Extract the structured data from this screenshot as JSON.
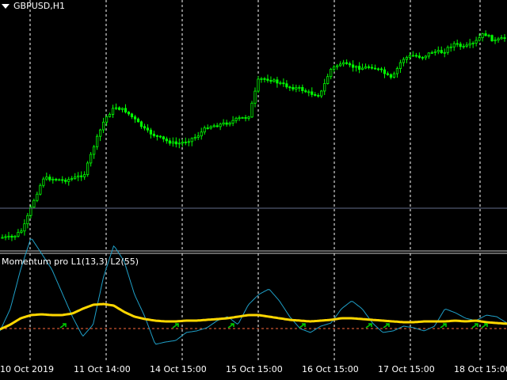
{
  "window": {
    "symbol_title": "GBPUSD,H1",
    "indicator_title": "Momentum pro L1(13,3) L2(55)"
  },
  "time_axis": {
    "labels": [
      "10 Oct 2019",
      "11 Oct 14:00",
      "14 Oct 15:00",
      "15 Oct 15:00",
      "16 Oct 15:00",
      "17 Oct 15:00",
      "18 Oct 15:00"
    ]
  },
  "colors": {
    "background": "#000000",
    "grid": "#ffffff",
    "candle": "#00ff00",
    "momentum_fast": "#1fa0c8",
    "momentum_slow": "#ffd700",
    "signal_arrow": "#00c800",
    "zero_level": "#ff6a3c"
  },
  "chart_data": [
    {
      "type": "candlestick",
      "series_name": "GBPUSD,H1",
      "x_labels": [
        "10 Oct 2019",
        "11 Oct 14:00",
        "14 Oct 15:00",
        "15 Oct 15:00",
        "16 Oct 15:00",
        "17 Oct 15:00",
        "18 Oct 15:00"
      ],
      "trend_closes": [
        300,
        300,
        290,
        255,
        225,
        226,
        228,
        225,
        220,
        182,
        150,
        135,
        140,
        152,
        165,
        172,
        178,
        182,
        178,
        172,
        160,
        158,
        155,
        150,
        148,
        100,
        100,
        105,
        110,
        112,
        118,
        120,
        88,
        80,
        84,
        86,
        84,
        90,
        100,
        75,
        70,
        72,
        65,
        66,
        55,
        60,
        55,
        42,
        52,
        48
      ],
      "grid": true,
      "y_axis": "hidden"
    },
    {
      "type": "line",
      "series": [
        {
          "style": "thin",
          "values": [
            418,
            390,
            340,
            300,
            320,
            340,
            370,
            400,
            425,
            410,
            350,
            310,
            330,
            372,
            400,
            435,
            432,
            430,
            420,
            418,
            414,
            405,
            400,
            410,
            385,
            372,
            365,
            380,
            400,
            415,
            420,
            412,
            408,
            390,
            380,
            390,
            408,
            420,
            418,
            412,
            414,
            418,
            412,
            390,
            395,
            402,
            405,
            398,
            400,
            408
          ]
        },
        {
          "style": "thick",
          "values": [
            416,
            410,
            402,
            398,
            397,
            398,
            398,
            396,
            390,
            385,
            384,
            386,
            394,
            400,
            403,
            405,
            406,
            406,
            405,
            405,
            404,
            403,
            402,
            400,
            398,
            398,
            400,
            402,
            404,
            405,
            406,
            405,
            404,
            402,
            402,
            403,
            404,
            405,
            406,
            407,
            407,
            406,
            406,
            406,
            405,
            406,
            405,
            407,
            408,
            409
          ]
        }
      ],
      "reference_levels": [
        415
      ],
      "signal_arrows": 9,
      "grid": true
    }
  ]
}
